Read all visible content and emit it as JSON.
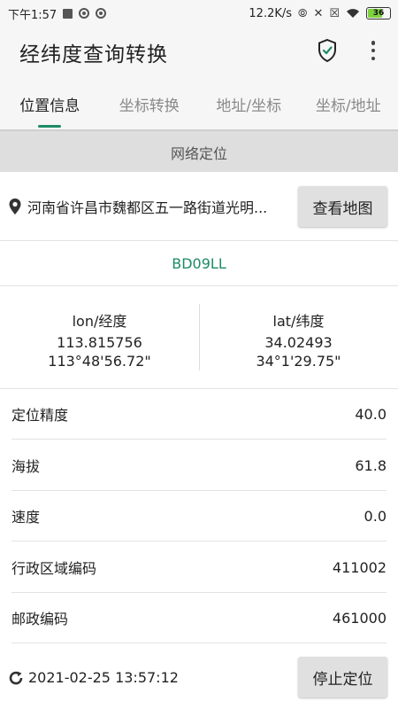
{
  "status_bar": {
    "time": "下午1:57",
    "network_speed": "12.2K/s",
    "battery": "36"
  },
  "app": {
    "title": "经纬度查询转换"
  },
  "tabs": [
    {
      "label": "位置信息",
      "active": true
    },
    {
      "label": "坐标转换",
      "active": false
    },
    {
      "label": "地址/坐标",
      "active": false
    },
    {
      "label": "坐标/地址",
      "active": false
    }
  ],
  "location_mode": "网络定位",
  "address": {
    "text": "河南省许昌市魏都区五一路街道光明...",
    "map_button": "查看地图"
  },
  "coord_system": "BD09LL",
  "longitude": {
    "label": "lon/经度",
    "decimal": "113.815756",
    "dms": "113°48'56.72\""
  },
  "latitude": {
    "label": "lat/纬度",
    "decimal": "34.02493",
    "dms": "34°1'29.75\""
  },
  "info_rows": [
    {
      "label": "定位精度",
      "value": "40.0"
    },
    {
      "label": "海拔",
      "value": "61.8"
    },
    {
      "label": "速度",
      "value": "0.0"
    },
    {
      "label": "行政区域编码",
      "value": "411002"
    },
    {
      "label": "邮政编码",
      "value": "461000"
    }
  ],
  "footer": {
    "timestamp": "2021-02-25 13:57:12",
    "stop_button": "停止定位"
  },
  "colors": {
    "accent": "#1e8a66",
    "band": "#dedede",
    "button": "#e0e0e0"
  }
}
